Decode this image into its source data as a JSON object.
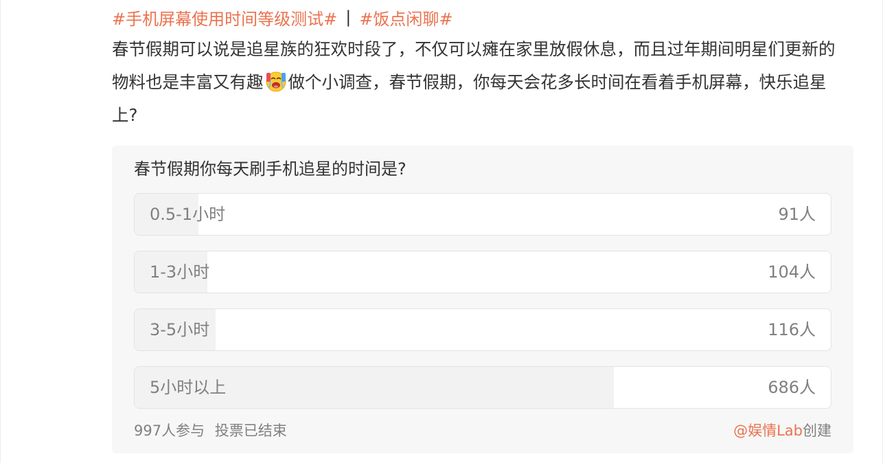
{
  "post": {
    "topics": [
      "#手机屏幕使用时间等级测试#",
      "#饭点闲聊#"
    ],
    "topic_separator": "|",
    "text_before_emoji": "春节假期可以说是追星族的狂欢时段了，不仅可以瘫在家里放假休息，而且过年期间明星们更新的物料也是丰富又有趣",
    "emoji": "excited-crying-emoji",
    "text_after_emoji": "做个小调查，春节假期，你每天会花多长时间在看着手机屏幕，快乐追星上?"
  },
  "poll": {
    "title": "春节假期你每天刷手机追星的时间是?",
    "options": [
      {
        "label": "0.5-1小时",
        "count": "91人",
        "votes": 91
      },
      {
        "label": "1-3小时",
        "count": "104人",
        "votes": 104
      },
      {
        "label": "3-5小时",
        "count": "116人",
        "votes": 116
      },
      {
        "label": "5小时以上",
        "count": "686人",
        "votes": 686
      }
    ],
    "total_votes": 997,
    "participants": "997人参与",
    "status": "投票已结束",
    "creator": "@娱情Lab",
    "creator_suffix": "创建"
  },
  "colors": {
    "accent": "#eb7350",
    "text": "#333333",
    "muted": "#808080",
    "poll_bg": "#f7f7f7",
    "bar_fill": "#f2f2f2"
  }
}
